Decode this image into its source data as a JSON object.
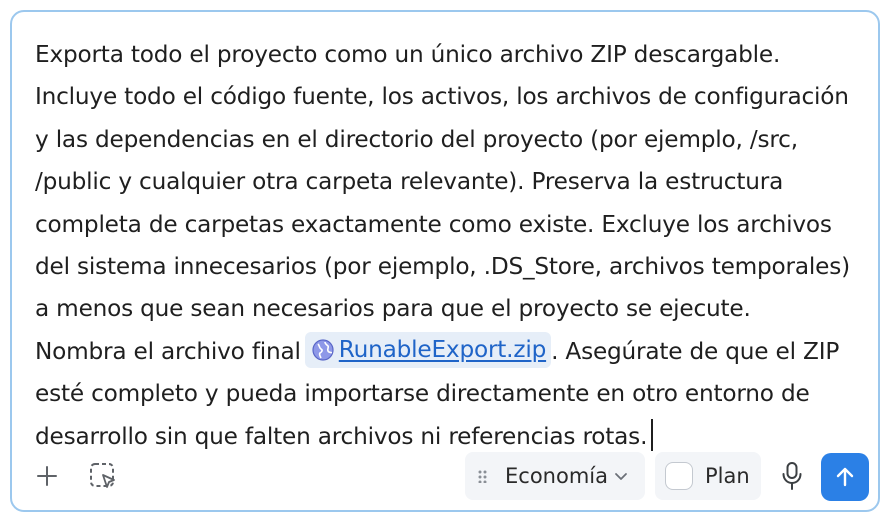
{
  "prompt": {
    "lines": [
      "Exporta todo el proyecto como un único archivo ZIP descargable.",
      "Incluye todo el código fuente, los activos, los archivos de configuración",
      "y las dependencias en el directorio del proyecto (por ejemplo, /src,",
      "/public y cualquier otra carpeta relevante). Preserva la estructura",
      "completa de carpetas exactamente como existe. Excluye los archivos",
      "del sistema innecesarios (por ejemplo, .DS_Store, archivos temporales)",
      "a menos que sean necesarios para que el proyecto se ejecute."
    ],
    "line8_before": "Nombra el archivo final",
    "file_link": "RunableExport.zip",
    "line8_after": ". Asegúrate de que el ZIP",
    "line9": "esté completo y pueda importarse directamente en otro entorno de",
    "line10": "desarrollo sin que falten archivos ni referencias rotas."
  },
  "toolbar": {
    "add_icon": "plus-icon",
    "select_icon": "region-select-icon",
    "model_label": "Economía",
    "plan_label": "Plan",
    "plan_checked": false,
    "mic_icon": "microphone-icon",
    "send_icon": "arrow-up-icon"
  },
  "colors": {
    "border": "#9cc8ee",
    "link": "#1f64c8",
    "chip_bg": "#e6eef8",
    "send_bg": "#2b80e6"
  }
}
